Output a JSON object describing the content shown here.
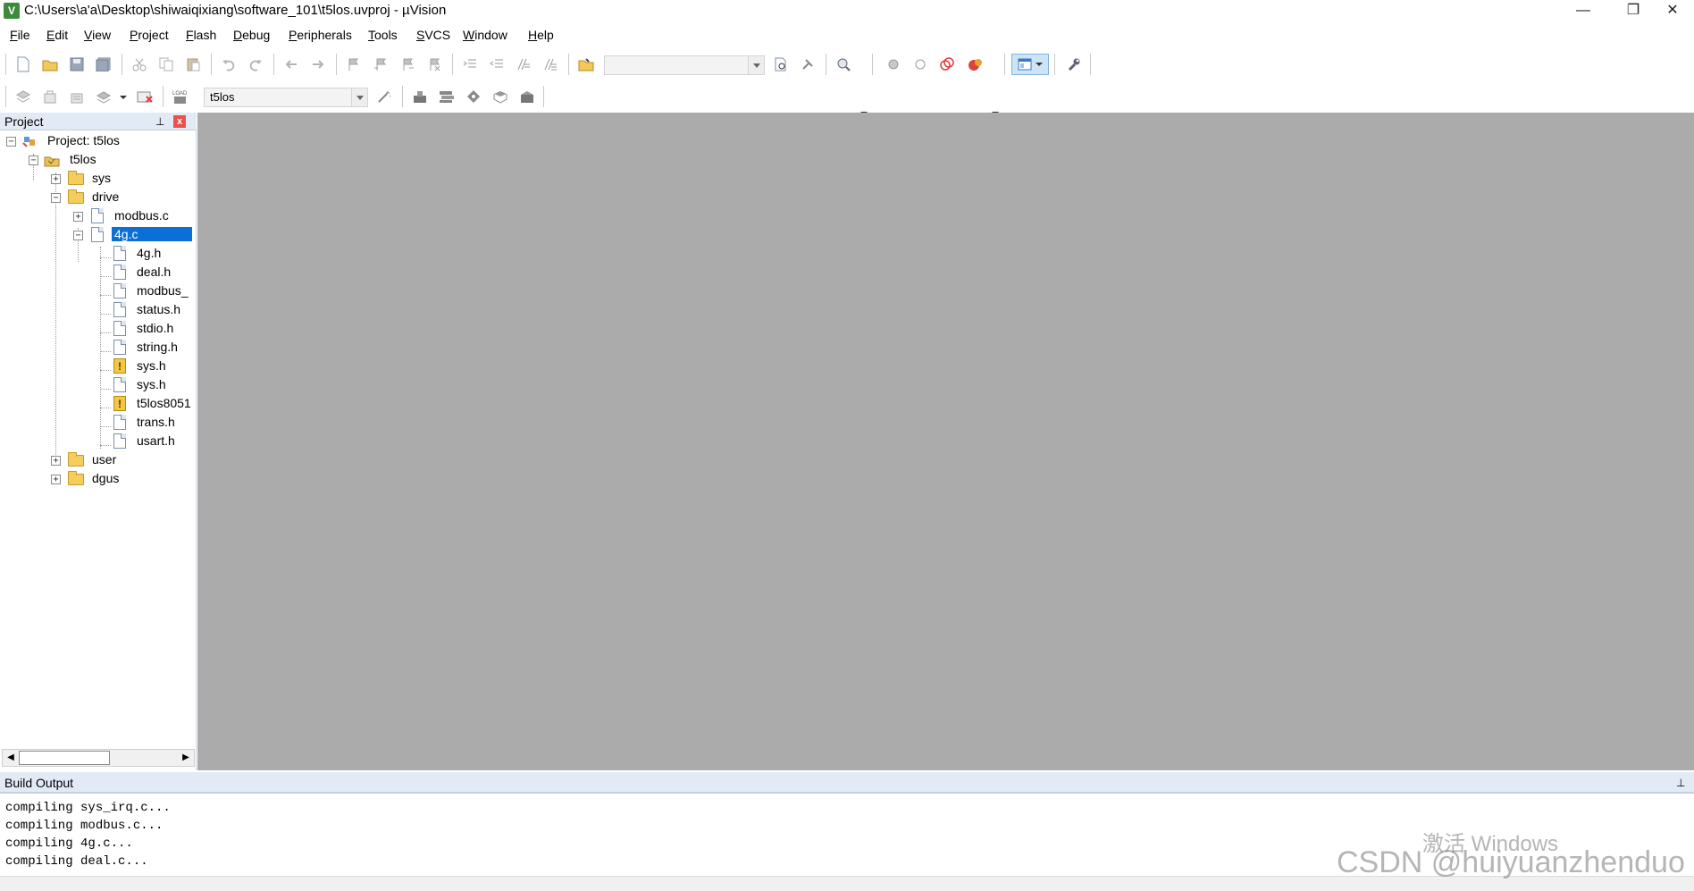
{
  "window": {
    "title": "C:\\Users\\a'a\\Desktop\\shiwaiqixiang\\software_101\\t5los.uvproj - µVision",
    "app_icon_glyph": "V",
    "minimize_glyph": "—",
    "restore_glyph": "❐",
    "close_glyph": "✕"
  },
  "menu": [
    {
      "id": "file",
      "hotkey": "F",
      "rest": "ile"
    },
    {
      "id": "edit",
      "hotkey": "E",
      "rest": "dit"
    },
    {
      "id": "view",
      "hotkey": "V",
      "rest": "iew"
    },
    {
      "id": "project",
      "hotkey": "P",
      "rest": "roject"
    },
    {
      "id": "flash",
      "hotkey": "F",
      "rest": "lash"
    },
    {
      "id": "debug",
      "hotkey": "D",
      "rest": "ebug"
    },
    {
      "id": "peripherals",
      "hotkey": "P",
      "rest": "eripherals"
    },
    {
      "id": "tools",
      "hotkey": "T",
      "rest": "ools"
    },
    {
      "id": "svcs",
      "hotkey": "S",
      "rest": "VCS"
    },
    {
      "id": "window",
      "hotkey": "W",
      "rest": "indow"
    },
    {
      "id": "help",
      "hotkey": "H",
      "rest": "elp"
    }
  ],
  "toolbar2": {
    "target_select_value": "t5los",
    "load_label": "LOAD"
  },
  "toolbar1": {
    "find_combo_value": ""
  },
  "project_panel": {
    "title": "Project",
    "pin_glyph": "⊥",
    "close_glyph": "x",
    "tree": [
      {
        "name": "tree-project-root",
        "label": "Project: t5los",
        "type": "project",
        "toggle": "−",
        "depth": 0
      },
      {
        "name": "tree-target-t5los",
        "label": "t5los",
        "type": "target",
        "toggle": "−",
        "depth": 1
      },
      {
        "name": "tree-group-sys",
        "label": "sys",
        "type": "folder",
        "toggle": "+",
        "depth": 2
      },
      {
        "name": "tree-group-drive",
        "label": "drive",
        "type": "folder-open",
        "toggle": "−",
        "depth": 2
      },
      {
        "name": "tree-file-modbus-c",
        "label": "modbus.c",
        "type": "file",
        "toggle": "+",
        "depth": 3
      },
      {
        "name": "tree-file-4g-c",
        "label": "4g.c",
        "type": "file",
        "toggle": "−",
        "depth": 3,
        "selected": true
      },
      {
        "name": "tree-include-4g-h",
        "label": "4g.h",
        "type": "file",
        "depth": 4
      },
      {
        "name": "tree-include-deal-h",
        "label": "deal.h",
        "type": "file",
        "depth": 4
      },
      {
        "name": "tree-include-modbus",
        "label": "modbus_",
        "type": "file",
        "depth": 4
      },
      {
        "name": "tree-include-status-h",
        "label": "status.h",
        "type": "file",
        "depth": 4
      },
      {
        "name": "tree-include-stdio-h",
        "label": "stdio.h",
        "type": "file",
        "depth": 4
      },
      {
        "name": "tree-include-string-h",
        "label": "string.h",
        "type": "file",
        "depth": 4
      },
      {
        "name": "tree-include-sys-h-warning",
        "label": "sys.h",
        "type": "warnfile",
        "depth": 4
      },
      {
        "name": "tree-include-sys-h",
        "label": "sys.h",
        "type": "file",
        "depth": 4
      },
      {
        "name": "tree-include-t5los8051",
        "label": "t5los8051",
        "type": "warnfile",
        "depth": 4
      },
      {
        "name": "tree-include-trans-h",
        "label": "trans.h",
        "type": "file",
        "depth": 4
      },
      {
        "name": "tree-include-usart-h",
        "label": "usart.h",
        "type": "file",
        "depth": 4
      },
      {
        "name": "tree-group-user",
        "label": "user",
        "type": "folder",
        "toggle": "+",
        "depth": 2
      },
      {
        "name": "tree-group-dgus",
        "label": "dgus",
        "type": "folder",
        "toggle": "+",
        "depth": 2
      }
    ],
    "warn_glyph": "!",
    "scroll_left_glyph": "◀",
    "scroll_right_glyph": "▶"
  },
  "build_output": {
    "title": "Build Output",
    "pin_glyph": "⊥",
    "lines": [
      "compiling sys_irq.c...",
      "compiling modbus.c...",
      "compiling 4g.c...",
      "compiling deal.c..."
    ]
  },
  "overlays": {
    "windows_activation": "激活 Windows",
    "csdn_watermark": "CSDN @huiyuanzhenduo"
  },
  "colors": {
    "editor_background": "#ababab",
    "selection": "#0a6fd6",
    "panel_header": "#e2ebf5"
  }
}
